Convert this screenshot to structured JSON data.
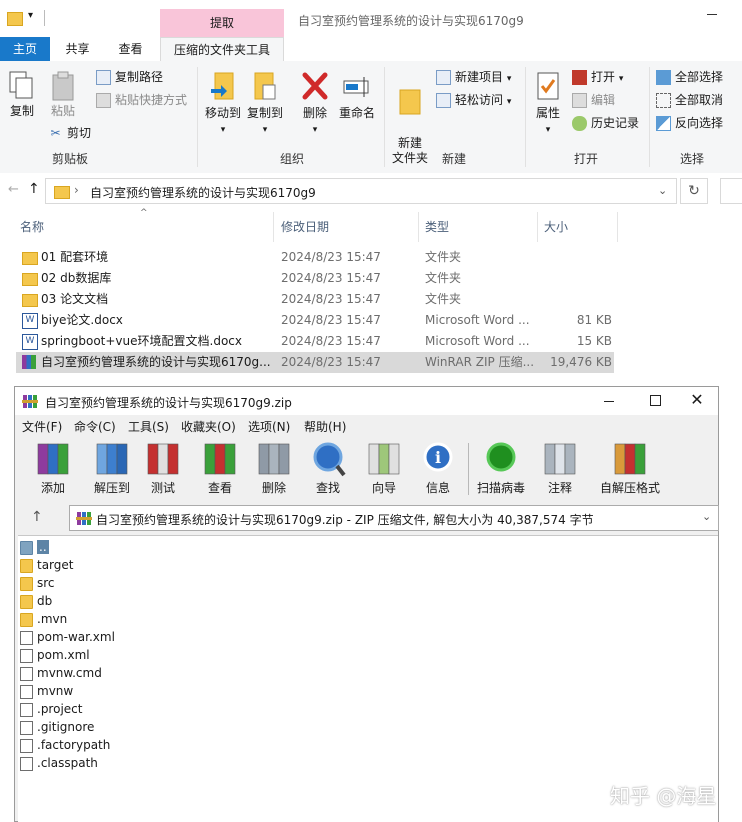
{
  "explorer": {
    "title": "自习室预约管理系统的设计与实现6170g9",
    "context_tab": "提取",
    "tabs": [
      "主页",
      "共享",
      "查看",
      "压缩的文件夹工具"
    ],
    "ribbon": {
      "copy": "复制",
      "paste": "粘贴",
      "copy_path": "复制路径",
      "paste_shortcut": "粘贴快捷方式",
      "cut": "剪切",
      "move_to": "移动到",
      "copy_to": "复制到",
      "delete": "删除",
      "rename": "重命名",
      "new_folder": "新建\n文件夹",
      "new_item": "新建项目",
      "easy_access": "轻松访问",
      "properties": "属性",
      "open": "打开",
      "edit": "编辑",
      "history": "历史记录",
      "select_all": "全部选择",
      "select_none": "全部取消",
      "invert_select": "反向选择",
      "groups": [
        "剪贴板",
        "组织",
        "新建",
        "打开",
        "选择"
      ]
    },
    "address": "自习室预约管理系统的设计与实现6170g9",
    "columns": [
      "名称",
      "修改日期",
      "类型",
      "大小"
    ],
    "files": [
      {
        "icon": "folder-icon",
        "name": "01 配套环境",
        "date": "2024/8/23 15:47",
        "type": "文件夹",
        "size": ""
      },
      {
        "icon": "folder-icon",
        "name": "02 db数据库",
        "date": "2024/8/23 15:47",
        "type": "文件夹",
        "size": ""
      },
      {
        "icon": "folder-icon",
        "name": "03 论文文档",
        "date": "2024/8/23 15:47",
        "type": "文件夹",
        "size": ""
      },
      {
        "icon": "word-doc-icon",
        "name": "biye论文.docx",
        "date": "2024/8/23 15:47",
        "type": "Microsoft Word ...",
        "size": "81 KB"
      },
      {
        "icon": "word-doc-icon",
        "name": "springboot+vue环境配置文档.docx",
        "date": "2024/8/23 15:47",
        "type": "Microsoft Word ...",
        "size": "15 KB"
      },
      {
        "icon": "winrar-zip-icon",
        "name": "自习室预约管理系统的设计与实现6170g...",
        "date": "2024/8/23 15:47",
        "type": "WinRAR ZIP 压缩...",
        "size": "19,476 KB"
      }
    ]
  },
  "winrar": {
    "title": "自习室预约管理系统的设计与实现6170g9.zip",
    "menu": [
      "文件(F)",
      "命令(C)",
      "工具(S)",
      "收藏夹(O)",
      "选项(N)",
      "帮助(H)"
    ],
    "toolbar": [
      "添加",
      "解压到",
      "测试",
      "查看",
      "删除",
      "查找",
      "向导",
      "信息",
      "扫描病毒",
      "注释",
      "自解压格式"
    ],
    "path": "自习室预约管理系统的设计与实现6170g9.zip - ZIP 压缩文件, 解包大小为 40,387,574 字节",
    "items": [
      {
        "type": "parent",
        "name": ".."
      },
      {
        "type": "folder",
        "name": "target"
      },
      {
        "type": "folder",
        "name": "src"
      },
      {
        "type": "folder",
        "name": "db"
      },
      {
        "type": "folder",
        "name": ".mvn"
      },
      {
        "type": "file",
        "name": "pom-war.xml"
      },
      {
        "type": "file",
        "name": "pom.xml"
      },
      {
        "type": "file",
        "name": "mvnw.cmd"
      },
      {
        "type": "file",
        "name": "mvnw"
      },
      {
        "type": "file",
        "name": ".project"
      },
      {
        "type": "file",
        "name": ".gitignore"
      },
      {
        "type": "file",
        "name": ".factorypath"
      },
      {
        "type": "file",
        "name": ".classpath"
      }
    ]
  },
  "watermark": "知乎 @海星",
  "colors": {
    "accent": "#0078d7",
    "context_tab": "#f9c5d9",
    "folder": "#f4c74d"
  }
}
